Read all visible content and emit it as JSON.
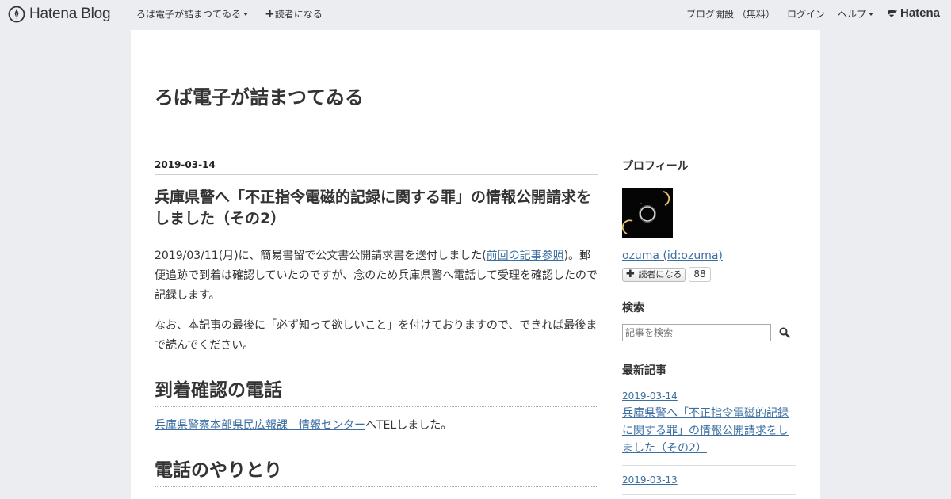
{
  "header": {
    "logo_text": "Hatena Blog",
    "blog_menu": "ろば電子が詰まつてゐる",
    "subscribe": "読者になる",
    "open_blog": "ブログ開設 （無料）",
    "login": "ログイン",
    "help": "ヘルプ",
    "hatena": "Hatena"
  },
  "blog": {
    "title": "ろば電子が詰まつてゐる"
  },
  "entry": {
    "date": "2019-03-14",
    "title": "兵庫県警へ「不正指令電磁的記録に関する罪」の情報公開請求をしました（その2）",
    "p1_before": "2019/03/11(月)に、簡易書留で公文書公開請求書を送付しました(",
    "p1_link": "前回の記事参照",
    "p1_after": ")。郵便追跡で到着は確認していたのですが、念のため兵庫県警へ電話して受理を確認したので記録します。",
    "p2": "なお、本記事の最後に「必ず知って欲しいこと」を付けておりますので、できれば最後まで読んでください。",
    "h1": "到着確認の電話",
    "p3_link": "兵庫県警察本部県民広報課　情報センター",
    "p3_after": "へTELしました。",
    "h2": "電話のやりとり"
  },
  "sidebar": {
    "profile_title": "プロフィール",
    "profile_name": "ozuma (id:ozuma)",
    "subscribe_label": "読者になる",
    "subscriber_count": "88",
    "search_title": "検索",
    "search_placeholder": "記事を検索",
    "recent_title": "最新記事",
    "recent": [
      {
        "date": "2019-03-14",
        "title": "兵庫県警へ「不正指令電磁的記録に関する罪」の情報公開請求をしました（その2）"
      },
      {
        "date": "2019-03-13",
        "title": ""
      }
    ]
  },
  "colors": {
    "link": "#3c6fa1",
    "header_bg": "#ebedf0"
  }
}
